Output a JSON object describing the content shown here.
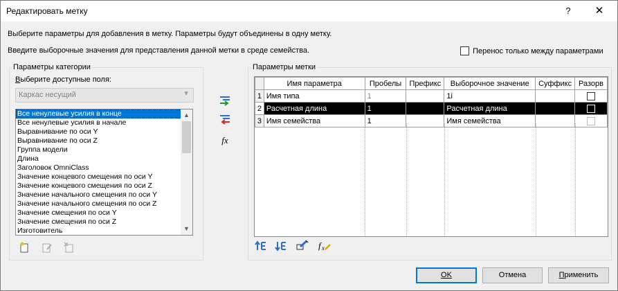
{
  "window": {
    "title": "Редактировать метку",
    "help": "?",
    "close": "✕"
  },
  "instructions": {
    "line1": "Выберите параметры для добавления в метку.  Параметры будут объединены в одну метку.",
    "line2": "Введите выборочные значения для представления данной метки в среде семейства.",
    "wrap_option": "Перенос только между параметрами"
  },
  "category": {
    "group_label": "Параметры категории",
    "fields_label": "Выберите доступные поля:",
    "combo_value": "Каркас несущий",
    "fields": [
      "Все ненулевые усилия в конце",
      "Все ненулевые усилия в начале",
      "Выравнивание по оси Y",
      "Выравнивание по оси Z",
      "Группа модели",
      "Длина",
      "Заголовок OmniClass",
      "Значение концевого смещения по оси Y",
      "Значение концевого смещения по оси Z",
      "Значение начального смещения по оси Y",
      "Значение начального смещения по оси Z",
      "Значение смещения по оси Y",
      "Значение смещения по оси Z",
      "Изготовитель"
    ],
    "selected_field": 0
  },
  "label_params": {
    "group_label": "Параметры метки",
    "columns": [
      "Имя параметра",
      "Пробелы",
      "Префикс",
      "Выборочное значение",
      "Суффикс",
      "Разорв"
    ],
    "rows": [
      {
        "num": "1",
        "name": "Имя типа",
        "spaces": "1",
        "prefix": "",
        "sample": "1i",
        "suffix": ""
      },
      {
        "num": "2",
        "name": "Расчетная длина",
        "spaces": "1",
        "prefix": "",
        "sample": "Расчетная длина",
        "suffix": ""
      },
      {
        "num": "3",
        "name": "Имя семейства",
        "spaces": "1",
        "prefix": "",
        "sample": "Имя семейства",
        "suffix": ""
      }
    ]
  },
  "buttons": {
    "ok": "OK",
    "cancel": "Отмена",
    "apply": "Применить"
  },
  "icons": {
    "fx": "fx",
    "accent": "#0078d7"
  }
}
